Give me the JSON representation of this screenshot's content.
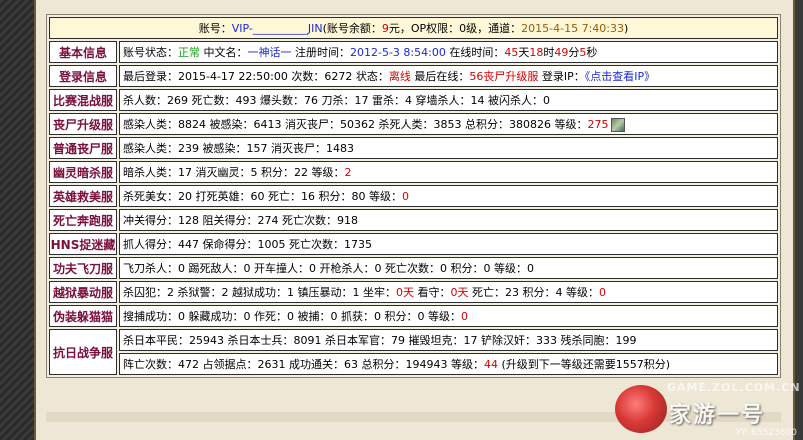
{
  "header": {
    "account_label": "账号：",
    "account_value": "VIP-__________JIN",
    "balance_label": "(账号余额：",
    "balance_value": "9",
    "balance_unit": "元，",
    "op_label": "OP权限：",
    "op_value": "0级，",
    "channel_label": "通道：",
    "channel_value": "2015-4-15 7:40:33",
    "close_paren": ")"
  },
  "rows": {
    "basic": {
      "label": "基本信息",
      "status_label": "账号状态：",
      "status_value": "正常",
      "cn_name_label": " 中文名：",
      "cn_name_value": "一神话一",
      "reg_label": " 注册时间：",
      "reg_value": "2012-5-3 8:54:00",
      "online_label": " 在线时间：",
      "online_h": "45",
      "online_h_unit": "天",
      "online_m": "18",
      "online_m_unit": "时",
      "online_s": "49",
      "online_s_unit": "分",
      "online_x": "5",
      "online_x_unit": "秒"
    },
    "login": {
      "label": "登录信息",
      "last_login_label": "最后登录：",
      "last_login_value": "2015-4-17 22:50:00",
      "count_label": " 次数：",
      "count_value": "6272",
      "state_label": " 状态：",
      "state_value": "离线",
      "last_online_label": " 最后在线：",
      "last_online_value": "56丧尸升级服",
      "ip_label": " 登录IP：",
      "ip_value": "《点击查看IP》"
    },
    "mix": {
      "label": "比赛混战服",
      "text": "杀人数：269 死亡数：493 爆头数：76 刀杀：17 雷杀：4 穿墙杀人：14 被闪杀人：0"
    },
    "zombie_up": {
      "label": "丧尸升级服",
      "text": "感染人类：8824 被感染：6413 消灭丧尸：50362 杀死人类：3853 总积分：380826 等级：",
      "level": "275"
    },
    "zombie": {
      "label": "普通丧尸服",
      "text": "感染人类：239 被感染：157 消灭丧尸：1483"
    },
    "ghost": {
      "label": "幽灵暗杀服",
      "text": "暗杀人类：17 消灭幽灵：5 积分：22 等级：",
      "level": "2"
    },
    "hero": {
      "label": "英雄救美服",
      "text": "杀死美女：20 打死英雄：60 死亡：16 积分：80 等级：",
      "level": "0"
    },
    "death_run": {
      "label": "死亡奔跑服",
      "text": "冲关得分：128 阻关得分：274 死亡次数：918"
    },
    "hns": {
      "label": "HNS捉迷藏",
      "text": "抓人得分：447 保命得分：1005 死亡次数：1735"
    },
    "kungfu": {
      "label": "功夫飞刀服",
      "text": "飞刀杀人：0 踢死敌人：0 开车撞人：0 开枪杀人：0 死亡次数：0 积分：0 等级：0"
    },
    "jail": {
      "label": "越狱暴动服",
      "text_a": "杀囚犯：2 杀狱警：2 越狱成功：1 镇压暴动：1 坐牢：",
      "jail_days": "0天",
      "text_b": " 看守：",
      "guard_days": "0天",
      "text_c": " 死亡：23 积分：4 等级：",
      "level": "0"
    },
    "disguise": {
      "label": "伪装躲猫猫",
      "text": "搜捕成功：0 躲藏成功：0 作死：0 被捕：0 抓获：0 积分：0 等级：",
      "level": "0"
    },
    "anti_war": {
      "label": "抗日战争服",
      "line1": "杀日本平民：25943 杀日本士兵：8091 杀日本军官：79 摧毁坦克：17 铲除汉奸：333 残杀同胞：199",
      "line2_a": "阵亡次数：472 占领据点：2631 成功通关：63 总积分：194943 等级：",
      "level": "44",
      "line2_b": " (升级到下一等级还需要1557积分)"
    }
  },
  "watermark": {
    "top": "GAME.ZOL.COM.CN",
    "brand": "家游一号",
    "id": "YY: 65523800"
  },
  "colors": {
    "label": "#7a0f3c",
    "red": "#d40000",
    "blue": "#1a2ad8",
    "green": "#17a117",
    "header_bg": "#fff8d8"
  }
}
